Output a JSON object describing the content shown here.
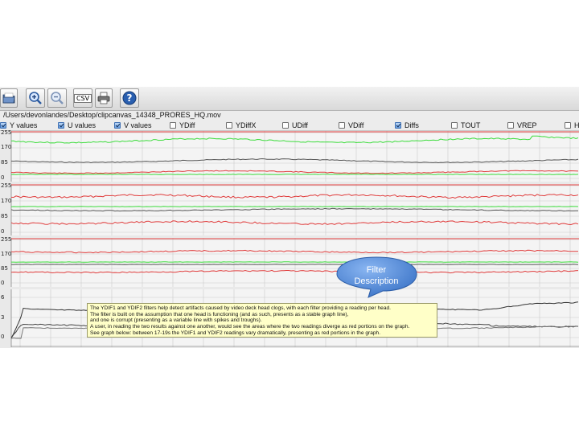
{
  "file_path": "/Users/devonlandes/Desktop/clipcanvas_14348_PRORES_HQ.mov",
  "toolbar": {
    "csv_label": "CSV"
  },
  "filters": [
    {
      "label": "Y values",
      "checked": true
    },
    {
      "label": "U values",
      "checked": true
    },
    {
      "label": "V values",
      "checked": true
    },
    {
      "label": "YDiff",
      "checked": false
    },
    {
      "label": "YDiffX",
      "checked": false
    },
    {
      "label": "UDiff",
      "checked": false
    },
    {
      "label": "VDiff",
      "checked": false
    },
    {
      "label": "Diffs",
      "checked": true
    },
    {
      "label": "TOUT",
      "checked": false
    },
    {
      "label": "VREP",
      "checked": false
    },
    {
      "label": "H",
      "checked": false
    }
  ],
  "graphs": {
    "y": {
      "ticks": [
        "255",
        "170",
        "85",
        "0"
      ]
    },
    "u": {
      "ticks": [
        "255",
        "170",
        "85",
        "0"
      ]
    },
    "v": {
      "ticks": [
        "255",
        "170",
        "85",
        "0"
      ]
    },
    "diffs": {
      "ticks": [
        "6",
        "3",
        "0"
      ]
    }
  },
  "callout": {
    "line1": "Filter",
    "line2": "Description"
  },
  "tooltip": {
    "lines": [
      "The YDIF1 and YDIF2 filters help detect artifacts caused by video deck head clogs, with each filter providing a reading per head.",
      "The filter is built on the assumption that one head is functioning (and as such, presents as a stable graph line),",
      "and one is corrupt (presenting as a variable line with spikes and troughs).",
      "A user, in reading the two results against one another, would see the areas where the two readings diverge as red portions on the graph.",
      "See graph below: between 17-19s the YDIF1 and YDIF2 readings vary dramatically, presenting as red portions in the graph."
    ]
  },
  "colors": {
    "green": "#3cdc3c",
    "red": "#e03c3c",
    "dark": "#555555",
    "grid": "#c9c9c9"
  },
  "icons": [
    "folder-icon",
    "zoom-in-icon",
    "zoom-out-icon",
    "csv-icon",
    "printer-icon",
    "help-icon"
  ]
}
